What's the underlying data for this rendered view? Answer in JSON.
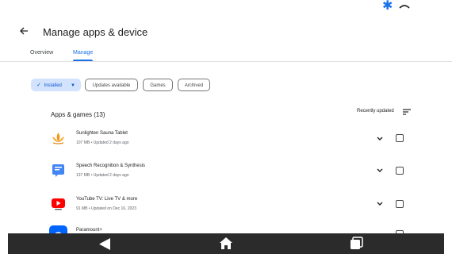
{
  "status_bar": {
    "bluetooth_icon": "bluetooth-icon",
    "wifi_icon": "wifi-icon"
  },
  "header": {
    "title": "Manage apps & device",
    "back_icon": "arrow-back-icon"
  },
  "tabs": [
    {
      "label": "Overview",
      "active": false
    },
    {
      "label": "Manage",
      "active": true
    }
  ],
  "filters": {
    "installed": "Installed",
    "updates_available": "Updates available",
    "games": "Games",
    "archived": "Archived"
  },
  "section": {
    "title": "Apps & games (13)",
    "sort_label": "Recently updated",
    "sort_icon": "sort-icon"
  },
  "apps": [
    {
      "name": "Sunlighten Sauna Tablet",
      "meta": "107 MB • Updated 2 days ago",
      "icon": "sunlighten-app-icon"
    },
    {
      "name": "Speech Recognition & Synthesis",
      "meta": "137 MB • Updated 2 days ago",
      "icon": "speech-services-app-icon"
    },
    {
      "name": "YouTube TV: Live TV & more",
      "meta": "91 MB • Updated on Dec 16, 2023",
      "icon": "youtube-tv-app-icon"
    },
    {
      "name": "Paramount+",
      "meta": "",
      "icon": "paramount-app-icon"
    }
  ],
  "navbar": {
    "back": "nav-back-icon",
    "home": "nav-home-icon",
    "recents": "nav-recents-icon"
  },
  "colors": {
    "accent": "#1a73e8",
    "chip_selected_bg": "#d3e3fd",
    "navbar_bg": "#2b2b2b"
  }
}
